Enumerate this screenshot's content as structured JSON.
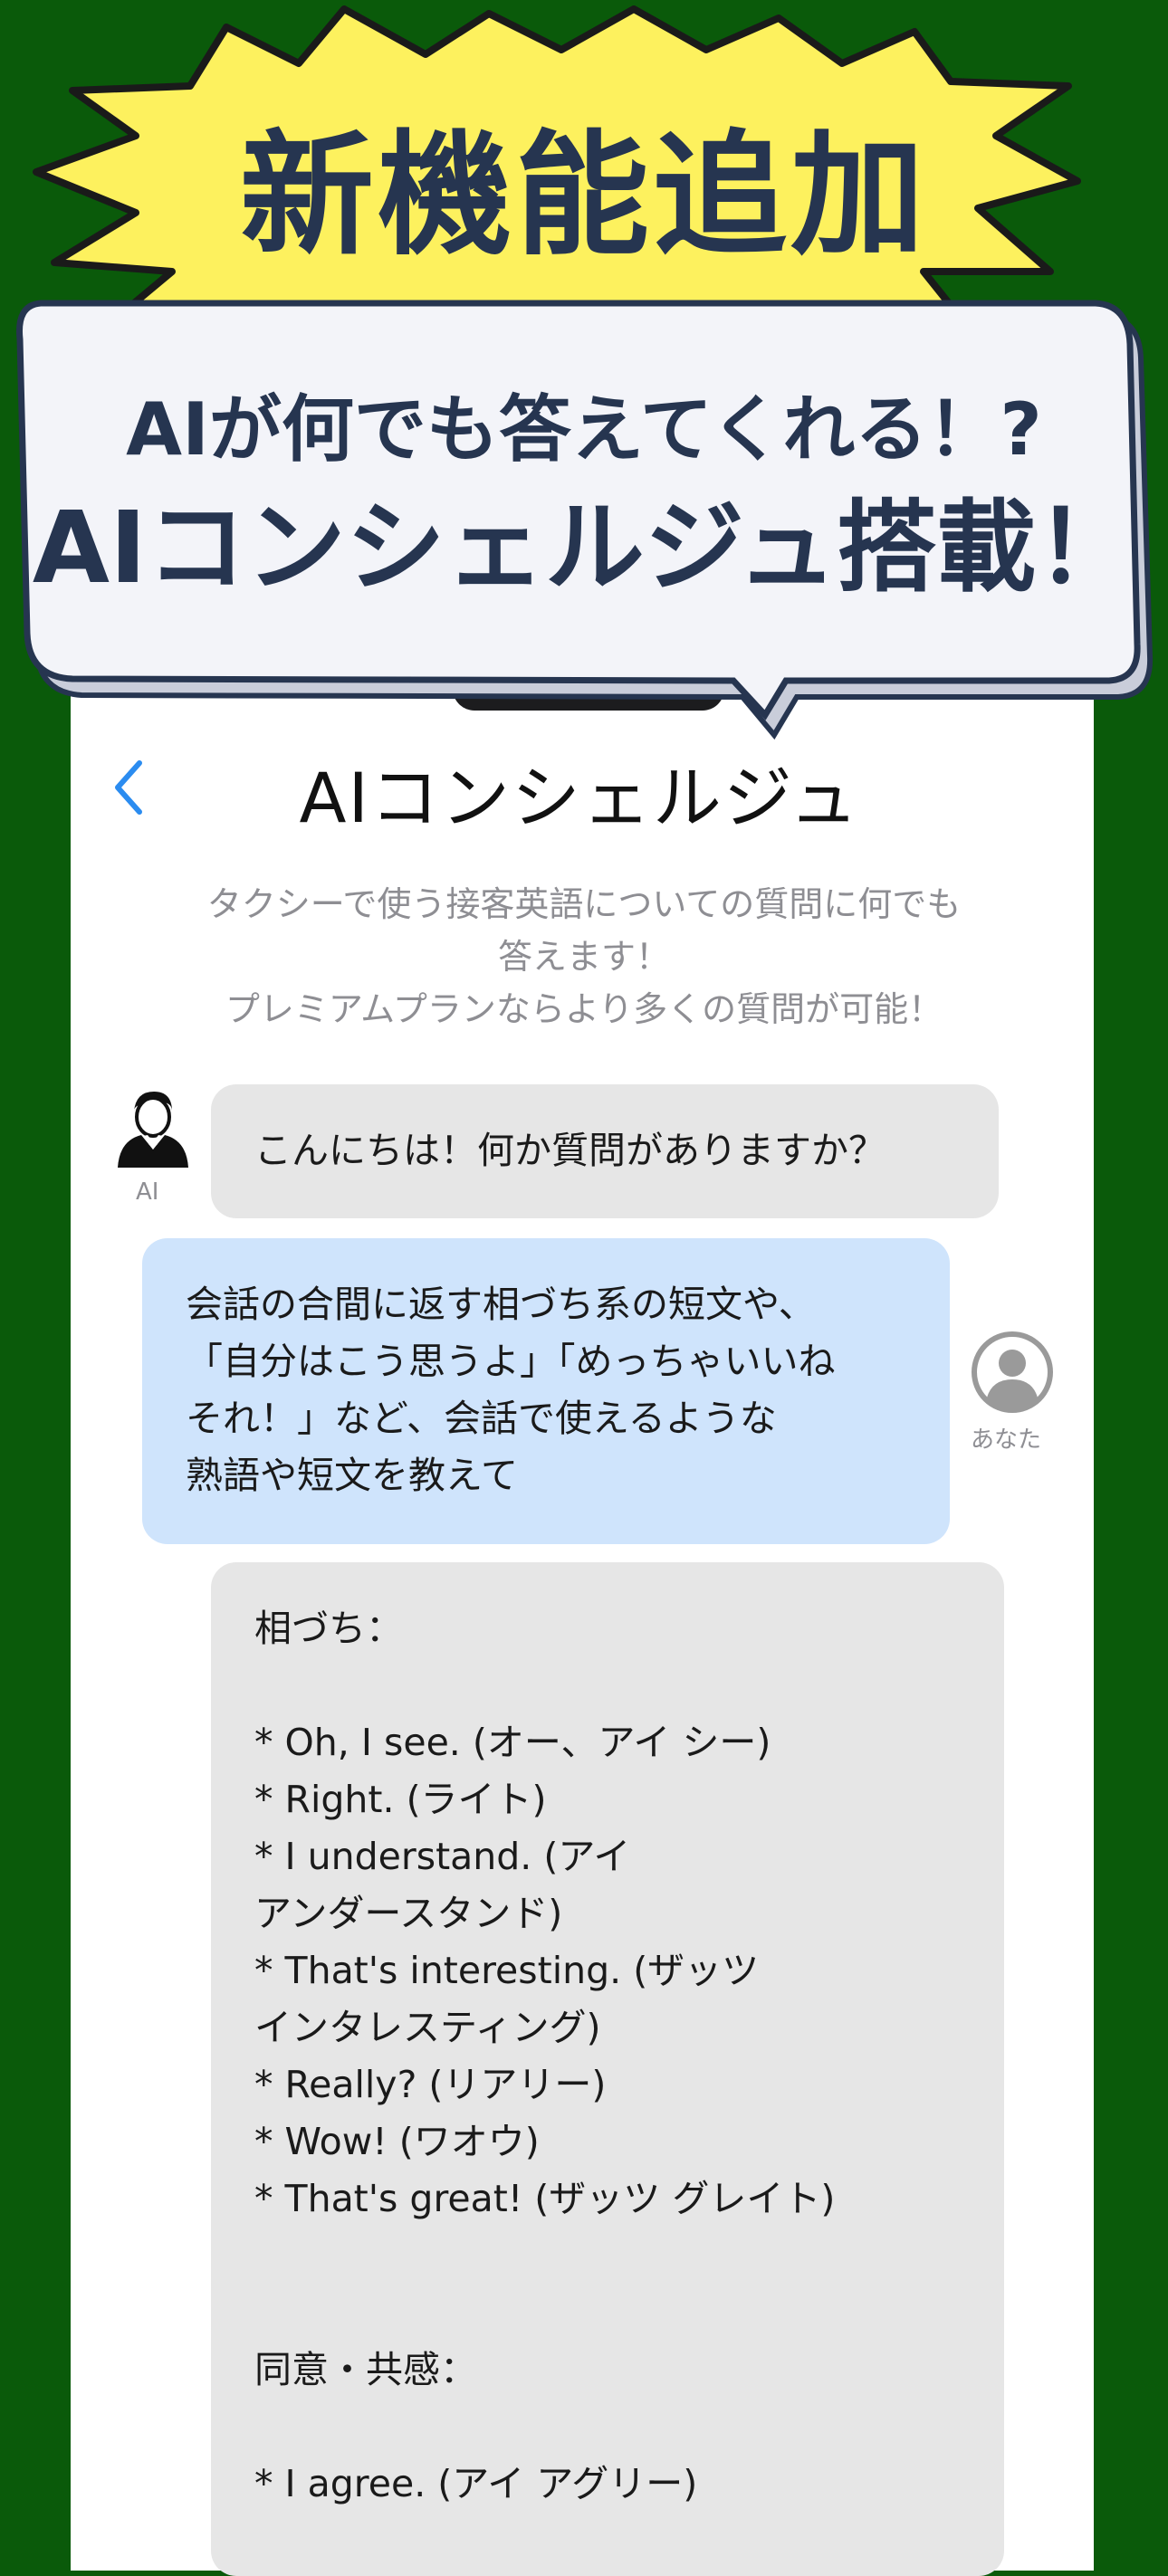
{
  "banner": {
    "headline": "新機能追加",
    "subtitle": "AIが何でも答えてくれる！?",
    "title": "AIコンシェルジュ搭載！"
  },
  "nav": {
    "back_icon": "chevron-left-icon",
    "title": "AIコンシェルジュ"
  },
  "intro": {
    "lines": [
      "タクシーで使う接客英語についての質問に何でも",
      "答えます！",
      "プレミアムプランならより多くの質問が可能！"
    ]
  },
  "chat": {
    "ai_label": "AI",
    "user_label": "あなた",
    "messages": [
      {
        "sender": "ai",
        "lines": [
          "こんにちは！何か質問がありますか？"
        ]
      },
      {
        "sender": "user",
        "lines": [
          "会話の合間に返す相づち系の短文や、",
          "「自分はこう思うよ」「めっちゃいいね",
          "それ！」など、会話で使えるような",
          "熟語や短文を教えて"
        ]
      },
      {
        "sender": "ai",
        "lines": [
          "相づち：",
          "",
          "* Oh, I see. (オー、アイ シー)",
          "* Right. (ライト)",
          "* I understand. (アイ",
          "アンダースタンド)",
          "* That's interesting. (ザッツ",
          "インタレスティング)",
          "* Really? (リアリー)",
          "* Wow! (ワオウ)",
          "* That's great! (ザッツ グレイト)",
          "",
          "",
          "同意・共感：",
          "",
          "* I agree. (アイ アグリー)"
        ]
      }
    ]
  },
  "colors": {
    "background": "#0a5a0a",
    "burst": "#fdf15e",
    "text_dark": "#263550",
    "accent_blue": "#2b8cf0",
    "user_bubble": "#cfe4fc",
    "ai_bubble": "#e6e6e6"
  }
}
